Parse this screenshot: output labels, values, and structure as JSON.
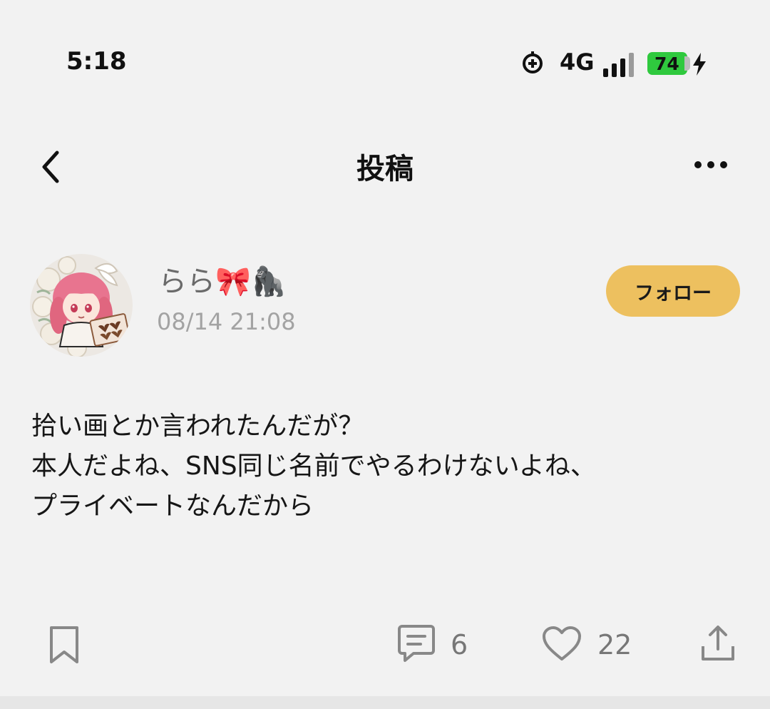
{
  "status_bar": {
    "time": "5:18",
    "network": "4G",
    "battery": "74",
    "icons": [
      "location-target-icon",
      "signal-bars-icon",
      "battery-icon",
      "charging-bolt-icon"
    ]
  },
  "header": {
    "title": "投稿",
    "back_icon": "chevron-left-icon",
    "more_icon": "more-dots-icon"
  },
  "post": {
    "author": {
      "name": "らら🎀🦍",
      "avatar_icon": "avatar-anime-girl"
    },
    "timestamp": "08/14 21:08",
    "follow_label": "フォロー",
    "body_lines": [
      "拾い画とか言われたんだが？",
      "本人だよね、SNS同じ名前でやるわけないよね、",
      "プライベートなんだから"
    ]
  },
  "actions": {
    "bookmark_icon": "bookmark-icon",
    "comment_icon": "comment-icon",
    "comment_count": "6",
    "like_icon": "heart-icon",
    "like_count": "22",
    "share_icon": "share-icon"
  },
  "colors": {
    "background": "#f2f2f2",
    "follow_button": "#edc05f",
    "battery": "#2fc93e",
    "muted_text": "#a3a3a3"
  }
}
